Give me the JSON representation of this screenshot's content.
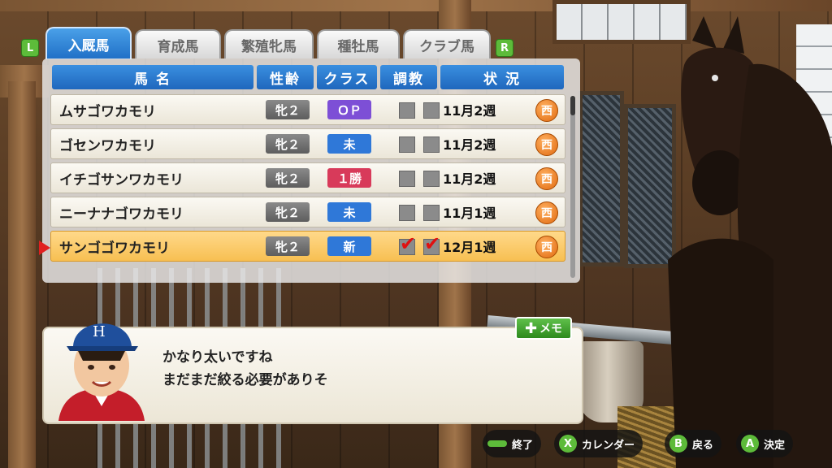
{
  "tabs": {
    "left_button": "L",
    "right_button": "R",
    "items": [
      "入厩馬",
      "育成馬",
      "繁殖牝馬",
      "種牡馬",
      "クラブ馬"
    ]
  },
  "table": {
    "headers": [
      "馬 名",
      "性齢",
      "クラス",
      "調教",
      "状 況"
    ],
    "rows": [
      {
        "name": "ムサゴワカモリ",
        "sex_age": "牝２",
        "class": "ＯＰ",
        "class_color": "#7d4fd6",
        "train1": false,
        "train2": false,
        "date": "11月2週",
        "region": "西"
      },
      {
        "name": "ゴセンワカモリ",
        "sex_age": "牝２",
        "class": "未",
        "class_color": "#2f78d8",
        "train1": false,
        "train2": false,
        "date": "11月2週",
        "region": "西"
      },
      {
        "name": "イチゴサンワカモリ",
        "sex_age": "牝２",
        "class": "１勝",
        "class_color": "#d83a5a",
        "train1": false,
        "train2": false,
        "date": "11月2週",
        "region": "西"
      },
      {
        "name": "ニーナナゴワカモリ",
        "sex_age": "牝２",
        "class": "未",
        "class_color": "#2f78d8",
        "train1": false,
        "train2": false,
        "date": "11月1週",
        "region": "西"
      },
      {
        "name": "サンゴゴワカモリ",
        "sex_age": "牝２",
        "class": "新",
        "class_color": "#2f78d8",
        "train1": true,
        "train2": true,
        "date": "12月1週",
        "region": "西"
      }
    ],
    "selected_index": 4
  },
  "dialog": {
    "memo_label": "メモ",
    "line1": "かなり太いですね",
    "line2": "まだまだ絞る必要がありそ"
  },
  "footer": {
    "end_label": "終了",
    "calendar_key": "X",
    "calendar_label": "カレンダー",
    "back_key": "B",
    "back_label": "戻る",
    "confirm_key": "A",
    "confirm_label": "決定"
  }
}
